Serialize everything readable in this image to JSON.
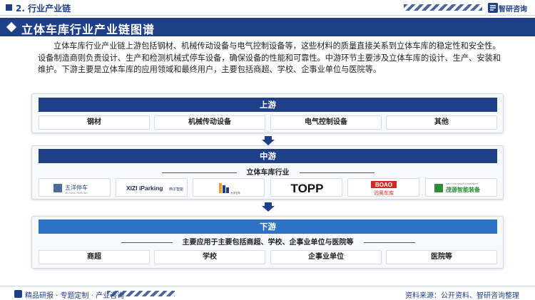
{
  "header": {
    "section": "2. 行业产业链",
    "brand": "智研咨询"
  },
  "title": "立体车库行业产业链图谱",
  "intro": "立体车库行业产业链上游包括钢材、机械传动设备与电气控制设备等，这些材料的质量直接关系到立体车库的稳定性和安全性。设备制造商则负责设计、生产和检测机械式停车设备，确保设备的性能和可靠性。中游环节主要涉及立体车库的设计、生产、安装和维护。下游主要是立体车库的应用领域和最终用户，主要包括商超、学校、企事业单位与医院等。",
  "upstream": {
    "label": "上游",
    "items": [
      "钢材",
      "机械传动设备",
      "电气控制设备",
      "其他"
    ]
  },
  "midstream": {
    "label": "中游",
    "sublabel": "立体车库行业",
    "companies": [
      {
        "name": "五洋停车",
        "sub": "WUYANG PARKING"
      },
      {
        "name": "XIZI iParking",
        "sub": "西子智能"
      },
      {
        "name": "大洋泊车",
        "sub": ""
      },
      {
        "name": "TOPP",
        "sub": ""
      },
      {
        "name": "BOAO",
        "sub": "泊奥车库"
      },
      {
        "name": "茂源智能装备",
        "sub": "MAOYUAN SMART EQUIPMENT"
      }
    ]
  },
  "downstream": {
    "label": "下游",
    "sublabel": "主要应用于主要包括商超、学校、企事业单位与医院等",
    "items": [
      "商超",
      "学校",
      "企事业单位",
      "医院等"
    ]
  },
  "footer": {
    "left": "精品研报 · 专题定制 · 产业咨询",
    "right": "资料来源：公开资料、智研咨询整理"
  },
  "colors": {
    "primary": "#1f3f86",
    "secondary": "#2f73c9"
  }
}
